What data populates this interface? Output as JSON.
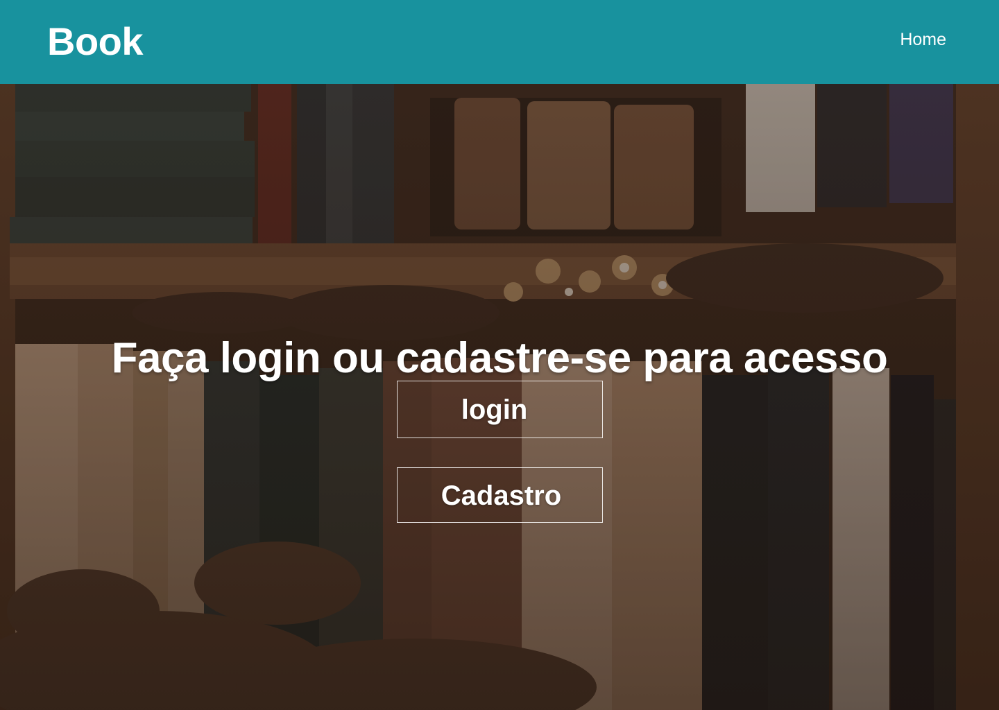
{
  "navbar": {
    "brand": "Book",
    "links": [
      {
        "label": "Home"
      }
    ],
    "background_color": "#18929e"
  },
  "hero": {
    "headline": "Faça login ou cadastre-se para acesso",
    "buttons": {
      "login_label": "login",
      "signup_label": "Cadastro"
    },
    "background_image": "bookshelf-photo"
  }
}
